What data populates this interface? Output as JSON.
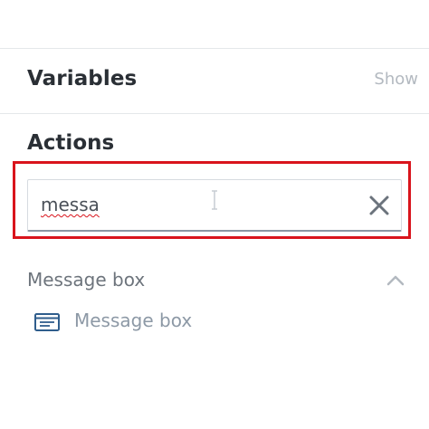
{
  "variables_section": {
    "title": "Variables",
    "toggle_label": "Show"
  },
  "actions_section": {
    "title": "Actions",
    "search": {
      "value": "messa"
    },
    "groups": [
      {
        "name": "Message box",
        "items": [
          {
            "label": "Message box",
            "icon": "message-box-icon"
          }
        ]
      }
    ]
  },
  "colors": {
    "highlight": "#d9141c",
    "heading": "#2a2f35",
    "muted": "#b3b9c0",
    "item_text": "#8d99a6",
    "icon_blue": "#2f5d8c"
  }
}
